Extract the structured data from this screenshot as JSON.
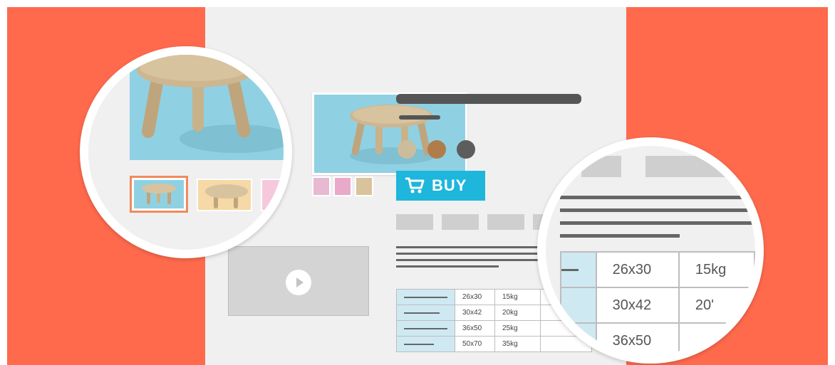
{
  "buy_button": {
    "label": "BUY"
  },
  "colors": {
    "background": "#ff6a4d",
    "page": "#f0f0f0",
    "accent": "#1fb6dc",
    "image_bg": "#8fd1e3",
    "swatches": [
      "#cbbd9c",
      "#b07d4a",
      "#5d5d5d"
    ]
  },
  "icons": {
    "cart": "shopping-cart-icon",
    "play": "play-icon",
    "stool": "stool-icon"
  },
  "specs_table": {
    "rows": [
      {
        "size": "26x30",
        "weight": "15kg"
      },
      {
        "size": "30x42",
        "weight": "20kg"
      },
      {
        "size": "36x50",
        "weight": "25kg"
      },
      {
        "size": "50x70",
        "weight": "35kg"
      }
    ]
  },
  "zoom_table": {
    "rows": [
      {
        "size": "26x30",
        "weight": "15kg"
      },
      {
        "size": "30x42",
        "weight": "20'"
      },
      {
        "size": "36x50",
        "weight": ""
      }
    ]
  }
}
